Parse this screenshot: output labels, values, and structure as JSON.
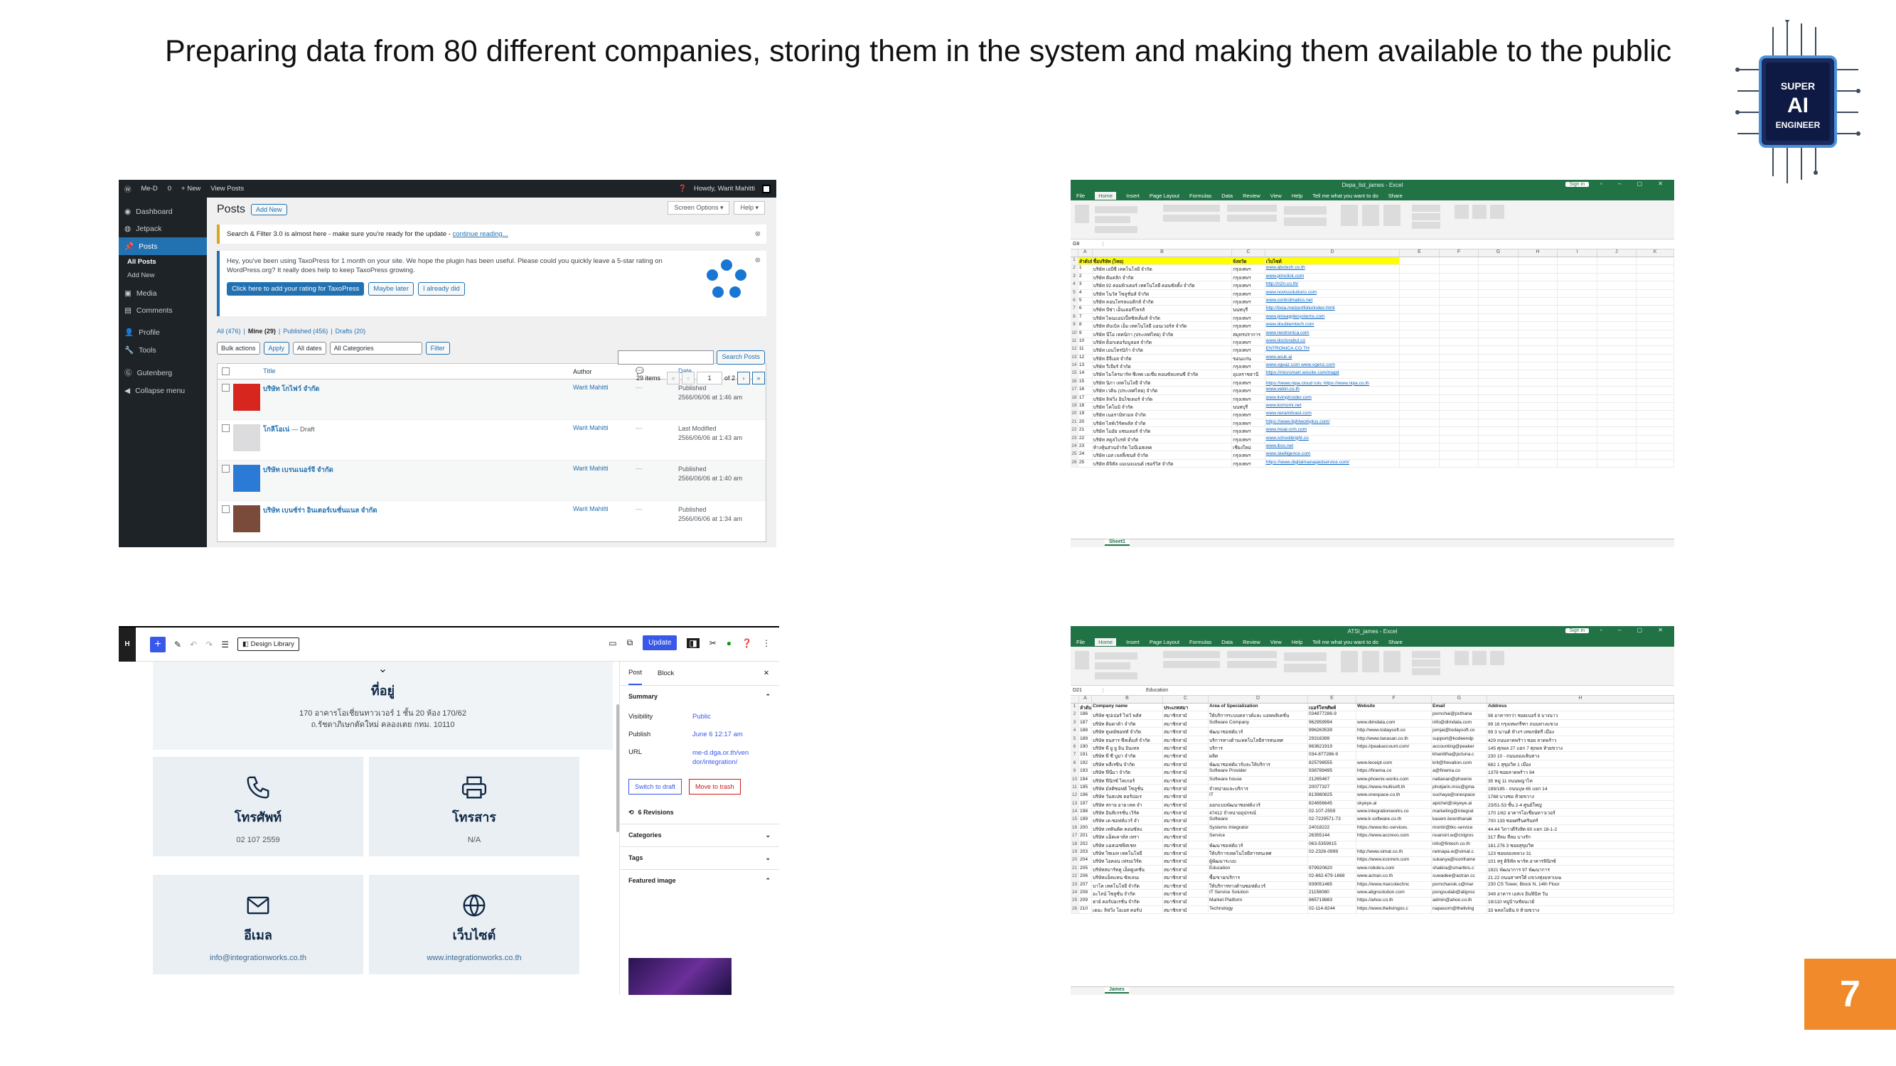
{
  "slide": {
    "title": "Preparing data from 80 different companies, storing them in the system and making them available to the public",
    "page_number": "7",
    "logo": {
      "line1": "SUPER",
      "line2": "AI",
      "line3": "ENGINEER"
    }
  },
  "wordpress": {
    "adminbar": {
      "site": "Me-D",
      "comments": "0",
      "new": "+ New",
      "view": "View Posts",
      "howdy": "Howdy, Warit Mahitti"
    },
    "menu": [
      "Dashboard",
      "Jetpack",
      "Posts",
      "Media",
      "Comments",
      "Profile",
      "Tools",
      "Gutenberg",
      "Collapse menu"
    ],
    "menu_sub": [
      "All Posts",
      "Add New"
    ],
    "title": "Posts",
    "add_new": "Add New",
    "screen_options": "Screen Options ▾",
    "help": "Help ▾",
    "notice1": {
      "text": "Search & Filter 3.0 is almost here - make sure you're ready for the update - ",
      "link": "continue reading..."
    },
    "notice2": {
      "text": "Hey, you've been using TaxoPress for 1 month on your site. We hope the plugin has been useful. Please could you quickly leave a 5-star rating on WordPress.org? It really does help to keep TaxoPress growing.",
      "btn_rate": "Click here to add your rating for TaxoPress",
      "btn_later": "Maybe later",
      "btn_did": "I already did"
    },
    "filters": {
      "all": "All (476)",
      "mine": "Mine (29)",
      "published": "Published (456)",
      "drafts": "Drafts (20)"
    },
    "search_button": "Search Posts",
    "bulk": "Bulk actions",
    "apply": "Apply",
    "dates": "All dates",
    "cats": "All Categories",
    "filter": "Filter",
    "items": "29 items",
    "page": "1",
    "of": "of 2",
    "columns": [
      "Title",
      "Author",
      "Date"
    ],
    "rows": [
      {
        "title": "บริษัท โกไฟว์ จำกัด",
        "draft": "",
        "author": "Warit Mahitti",
        "date": "Published\n2566/06/06 at 1:46 am",
        "thumb": "#d7261e"
      },
      {
        "title": "โกลีโอเน่",
        "draft": " — Draft",
        "author": "Warit Mahitti",
        "date": "Last Modified\n2566/06/06 at 1:43 am",
        "thumb": "#dcdcde"
      },
      {
        "title": "บริษัท เบรนเนอร์จี จำกัด",
        "draft": "",
        "author": "Warit Mahitti",
        "date": "Published\n2566/06/06 at 1:40 am",
        "thumb": "#2b7bd6"
      },
      {
        "title": "บริษัท เบนซ์ร่า อินเตอร์เนชั่นแนล จำกัด",
        "draft": "",
        "author": "Warit Mahitti",
        "date": "Published\n2566/06/06 at 1:34 am",
        "thumb": "#7a4b3a"
      }
    ]
  },
  "excel1": {
    "window_title": "Depa_list_james  -  Excel",
    "signin": "Sign in",
    "tabs": [
      "File",
      "Home",
      "Insert",
      "Page Layout",
      "Formulas",
      "Data",
      "Review",
      "View",
      "Help",
      "Tell me what you want to do",
      "Share"
    ],
    "namebox": "G8",
    "formula": "",
    "col_letters": [
      "",
      "A",
      "B",
      "C",
      "D",
      "E",
      "F",
      "G",
      "H",
      "I",
      "J",
      "K"
    ],
    "header": [
      "ลำดับที่",
      "ชื่อบริษัท (ไทย)",
      "จังหวัด",
      "เว็บไซต์"
    ],
    "rows": [
      [
        "1",
        "บริษัท เอบีซี เทคโนโลยี จำกัด",
        "กรุงเทพฯ",
        "www.abctech.co.th"
      ],
      [
        "2",
        "บริษัท ดิมคลิก จำกัด",
        "กรุงเทพฯ",
        "www.pimclick.com"
      ],
      [
        "3",
        "บริษัท 92 คอมพิวเตอร์ เทคโนโลยี คอนซัลติ้ง จำกัด",
        "กรุงเทพฯ",
        "http://n2n.co.th/"
      ],
      [
        "4",
        "บริษัท โนวัส โซลูชั่นส์ จำกัด",
        "กรุงเทพฯ",
        "www.novissolutions.com"
      ],
      [
        "5",
        "บริษัท คอนโทรลแมติกส์ จำกัด",
        "กรุงเทพฯ",
        "www.controlmatics.net"
      ],
      [
        "6",
        "บริษัท บีซ่า เอ็นเตอร์ไพรส์",
        "นนทบุรี",
        "http://bsia.me/portfolio/index.html"
      ],
      [
        "7",
        "บริษัท ไพนแอปเปิ้ลซิสเต็มส์ จำกัด",
        "กรุงเทพฯ",
        "www.pineapplesystems.com"
      ],
      [
        "8",
        "บริษัท ดับเบิล เอ็ม เทคโนโลยี แอนเวอร์ส จำกัด",
        "กรุงเทพฯ",
        "www.doublemtech.com"
      ],
      [
        "9",
        "บริษัท นีโอ เทคนิกา (ประเทศไทย) จำกัด",
        "สมุทรปราการ",
        "www.neotronica.com"
      ],
      [
        "10",
        "บริษัท ด็อกเตอร์อบูลอส จำกัด",
        "กรุงเทพฯ",
        "www.doctorabul.co"
      ],
      [
        "11",
        "บริษัท เอนโทรนิก้า จำกัด",
        "กรุงเทพฯ",
        "ENTRONICA.CO.TH"
      ],
      [
        "12",
        "บริษัท อีจีเอส จำกัด",
        "ขอนแก่น",
        "www.asuk.ai"
      ],
      [
        "13",
        "บริษัท วีเจียร์ จำกัด",
        "กรุงเทพฯ",
        "www.vgeaz.com www.vgenz.com"
      ],
      [
        "14",
        "บริษัท ไมโครมาร์ท ซีเทค เอเชีย คอนซัลแทนซี จำกัด",
        "อุบลราชธานี",
        "https://micromart.wixsite.com/mapit"
      ],
      [
        "15",
        "บริษัท นิภา เทคโนโลยี จำกัด",
        "กรุงเทพฯ",
        "https://www.nipa.cloud และ https://www.nipa.co.th"
      ],
      [
        "16",
        "บริษัท เวคิน (ประเทศไทย) จำกัด",
        "กรุงเทพฯ",
        "www.vekin.co.th"
      ],
      [
        "17",
        "บริษัท ลิฟวิ่ง อินไซเดอร์ จำกัด",
        "กรุงเทพฯ",
        "www.livinginsider.com"
      ],
      [
        "18",
        "บริษัท โคโมมิ จำกัด",
        "นนทบุรี",
        "www.komomi.net"
      ],
      [
        "19",
        "บริษัท เนอรามิทวอล จำกัด",
        "กรุงเทพฯ",
        "www.neramitvast.com"
      ],
      [
        "20",
        "บริษัท ไลท์เวิร์คพลัส จำกัด",
        "กรุงเทพฯ",
        "https://www.lightworkplus.com/"
      ],
      [
        "21",
        "บริษัท โมอัย แซนเดอร์ จำกัด",
        "กรุงเทพฯ",
        "www.moai-crm.com"
      ],
      [
        "22",
        "บริษัท สคูลไบรท์ จำกัด",
        "กรุงเทพฯ",
        "www.schoolbright.co"
      ],
      [
        "23",
        "ห้างหุ้นส่วนจำกัด ไอบีเอสเทค",
        "เชียงใหม่",
        "www.ibss.net"
      ],
      [
        "24",
        "บริษัท เอส เจลลี่เซนส์ จำกัด",
        "กรุงเทพฯ",
        "www.skelligence.com"
      ],
      [
        "25",
        "บริษัท ดิจิทัล แมเนจเมนต์ เซอร์วิส จำกัด",
        "กรุงเทพฯ",
        "https://www.digitalmanagedservice.com/"
      ]
    ],
    "sheet_tab": "Sheet1"
  },
  "excel2": {
    "window_title": "ATSI_james  -  Excel",
    "signin": "Sign in",
    "tabs": [
      "File",
      "Home",
      "Insert",
      "Page Layout",
      "Formulas",
      "Data",
      "Review",
      "View",
      "Help",
      "Tell me what you want to do",
      "Share"
    ],
    "namebox": "D21",
    "formula": "Education",
    "col_letters": [
      "",
      "A",
      "B",
      "C",
      "D",
      "E",
      "F",
      "G",
      "H"
    ],
    "header": [
      "ลำดับ",
      "Company name",
      "ประเภทสมา",
      "Area of Specialization",
      "เบอร์โทรศัพท์",
      "Website",
      "Email",
      "Address"
    ],
    "rows": [
      [
        "186",
        "บริษัท ซุปเปอร์ ไฟว์ พลัส",
        "สมาชิกสามั",
        "ให้บริการระบบคลาวด์และ แอพพลิเคชั่น",
        "034877286-9",
        "",
        "pornchai@pcthana",
        "98 อาคารกว่า ซอยเบอร์ 8 บางนาว"
      ],
      [
        "187",
        "บริษัท ดิมดาต้า จำกัด",
        "สมาชิกสามั",
        "Software Company",
        "962959994",
        "www.dimdata.com",
        "info@dimdata.com",
        "99 16 กรุงเทพกรีฑา ถนนทางแขวง"
      ],
      [
        "188",
        "บริษัท ทูเดย์ซอฟท์ จำกัด",
        "สมาชิกสามั",
        "พัฒนาซอฟต์แวร์",
        "996263539",
        "http://www.todaysoft.co",
        "jomjai@todaysoft.co",
        "99 3 นานต์ ห้างฯ เทพกษัตรี เมือง"
      ],
      [
        "189",
        "บริษัท ธนสาร ซีสเต็มส์ จำกัด",
        "สมาชิกสามั",
        "บริการทางด้านเทคโนโลยีสารสนเทศ",
        "29316399",
        "http://www.tanasan.co.th",
        "support@kodeendp",
        "429 ถนนลาดพร้าว ซอย ลาดพร้าว"
      ],
      [
        "190",
        "บริษัท พี ยู ยู อิน อินเทล",
        "สมาชิกสามั",
        "บริการ",
        "863621919",
        "https://peakaccount.com/",
        "accounting@peaker",
        "145 ศุภผล 27 แยก 7 ศุภผล ห้วยขวาง"
      ],
      [
        "191",
        "บริษัท พี ซี บูม่า จำกัด",
        "สมาชิกสามั",
        "ผลิต",
        "034-877286-9",
        "",
        "khanittha@pctuna.c",
        "230 10 - ถนนลองเส้นทาง"
      ],
      [
        "192",
        "บริษัท พลีเรซิน จำกัด",
        "สมาชิกสามั",
        "พัฒนาซอฟต์แวร์และให้บริการ",
        "825798555",
        "www.leceipt.com",
        "krit@frevation.com",
        "682 1 สุขุมวิท 1 เมือง"
      ],
      [
        "193",
        "บริษัท ฟีนีมา จำกัด",
        "สมาชิกสามั",
        "Software Provider",
        "938789495",
        "https://finema.co",
        "a@finema.co",
        "1379 ซอยลาดพร้าว 94"
      ],
      [
        "194",
        "บริษัท ฟีนิกซ์ ไทเกอร์",
        "สมาชิกสามั",
        "Software house",
        "21265467",
        "www.phoenix-works.com",
        "nattanan@phoenix",
        "35 หมู่ 11 ถนนพญาไท"
      ],
      [
        "195",
        "บริษัท มัลติซอฟต์ โซลูชั่น",
        "สมาชิกสามั",
        "จำหน่ายและบริการ",
        "20077327",
        "https://www.multisoft.th",
        "photjarin.mss@gma",
        "189/185 - ถนนบุษ 65 แยก 14"
      ],
      [
        "196",
        "บริษัท วันสเปซ คอร์ปอเร",
        "สมาชิกสามั",
        "IT",
        "813980825",
        "www.onespace.co.th",
        "suchaya@onespace",
        "1768 บางซอ ห้วยขวาง"
      ],
      [
        "197",
        "บริษัท สกาย อาย เทค จำ",
        "สมาชิกสามั",
        "ออกแบบพัฒนาซอฟต์แวร์",
        "824656645",
        "skyeye.ai",
        "apichet@skyeye.ai",
        "23/51-53 ชั้น 2-4 ศูนย์ใหญ่"
      ],
      [
        "198",
        "บริษัท อินทิเกรชั่น เวิร์ค",
        "สมาชิกสามั",
        "47412 จำหน่ายอุปกรณ์",
        "02-107-2559",
        "www.integrationworks.co",
        "marketing@integrat",
        "170 1/62 อาคารโอเชี่ยนทาวเวอร์"
      ],
      [
        "199",
        "บริษัท เค-ซอฟท์แวร์ จำ",
        "สมาชิกสามั",
        "Software",
        "02-7229571-73",
        "www.k-software.co.th",
        "kasem.boonthanak",
        "700 133 ซอยศรีนครินทร์"
      ],
      [
        "200",
        "บริษัท เทคินคิด คอนซัลแ",
        "สมาชิกสามั",
        "Systems Integrator",
        "24018222",
        "https://www.tkc-services.",
        "montri@tkc-service",
        "44.44 วิภาวดีรังสิต 60 แยก 18-1-2"
      ],
      [
        "201",
        "บริษัท แอ็คเคาท์ส เทรา",
        "สมาชิกสามั",
        "Service",
        "26355144",
        "https://www.accrevo.com",
        "nuansiri.w@cnigros",
        "317 สีลม สีลม บางรัก"
      ],
      [
        "202",
        "บริษัท แอสเอชฟิสเชท",
        "สมาชิกสามั",
        "พัฒนาซอฟต์แวร์",
        "063-5359915",
        "",
        "info@fintech.co.th",
        "181.276 3 ซอยสุขุมวิท"
      ],
      [
        "203",
        "บริษัท ไซเมท เทคโนโลยี",
        "สมาชิกสามั",
        "ให้บริการเทคโนโลยีสารสนเทศ",
        "02-2326-0999",
        "http://www.simat.co.th",
        "netnapa.w@simat.c",
        "123 ซอยลองหลวง 31"
      ],
      [
        "204",
        "บริษัท ไอคอน เฟรมเวิร์ค",
        "สมาชิกสามั",
        "ผู้พัฒนาระบบ",
        "",
        "https://www.iconrem.com",
        "sukanya@iconframe",
        "101 ทรู ดิจิทัล พาร์ค อาคารฟินิกซ์"
      ],
      [
        "205",
        "บริษัทสมาร์ทคู เอ็ดดูเคชั่น",
        "สมาชิกสามั",
        "Education",
        "979920620",
        "www.robokru.com",
        "shakira@smartkru.c",
        "1921 พัฒนาการ 97 พัฒนาการ"
      ],
      [
        "206",
        "บริษัทแอ็คแทน ซัลเลนเ",
        "สมาชิกสามั",
        "ซื้อ/ขาย/บริการ",
        "02-662-679-1668",
        "www.actran.co.th",
        "suwadee@actran.cc",
        "21.22 ถนนสาทรใต้ แขวงทุ่งมหาเมฆ"
      ],
      [
        "207",
        "บาโค เทคโนโลยี จำกัด",
        "สมาชิกสามั",
        "ให้บริการทางด้านซอฟต์แวร์",
        "939051465",
        "https://www.marcotechnc",
        "pornchanok.s@mar",
        "230 CS Tower, Block N, 14th Floor"
      ],
      [
        "208",
        "อะไลน์ โซลูชั่น จำกัด",
        "สมาชิกสามั",
        "IT Service Solution",
        "21158080",
        "www.alignsolution.com",
        "pongsudab@alignsc",
        "349 อาคาร เอสเจ อินฟินิท วัน"
      ],
      [
        "209",
        "ฮาย์ คอร์ปอเรชั่น จำกัด",
        "สมาชิกสามั",
        "Market Platform",
        "865719883",
        "https://ahoo.co.th",
        "admin@ahoo.co.th",
        "19/110 หมู่บ้านชัยนเวย์"
      ],
      [
        "210",
        "เดอะ ลิฟวิ่ง โอเอส คอร์ป",
        "สมาชิกสามั",
        "Technology",
        "02-114-8244",
        "https://www.thelivingos.c",
        "napasorn@theliving",
        "33 พหลโยธิน 9 ห้วยขวาง"
      ]
    ],
    "sheet_tab": "James"
  },
  "editor": {
    "logo": "H",
    "design_library": "Design Library",
    "update": "Update",
    "address_title": "ที่อยู่",
    "address_line1": "170 อาคารโอเชี่ยนทาวเวอร์ 1 ชั้น 20 ห้อง 170/62",
    "address_line2": "ถ.รัชดาภิเษกตัดใหม่ คลองเตย กทม. 10110",
    "cards": [
      {
        "title": "โทรศัพท์",
        "value": "02 107 2559",
        "icon": "phone-icon"
      },
      {
        "title": "โทรสาร",
        "value": "N/A",
        "icon": "printer-icon"
      },
      {
        "title": "อีเมล",
        "value": "info@integrationworks.co.th",
        "icon": "mail-icon"
      },
      {
        "title": "เว็บไซต์",
        "value": "www.integrationworks.co.th",
        "icon": "globe-icon"
      }
    ],
    "sidebar": {
      "tab_post": "Post",
      "tab_block": "Block",
      "summary": "Summary",
      "visibility_label": "Visibility",
      "visibility_value": "Public",
      "publish_label": "Publish",
      "publish_value": "June 6 12:17 am",
      "url_label": "URL",
      "url_value": "me-d.dga.or.th/vendor/integration/",
      "switch_draft": "Switch to draft",
      "move_trash": "Move to trash",
      "revisions": "6 Revisions",
      "categories": "Categories",
      "tags": "Tags",
      "featured": "Featured image"
    }
  }
}
